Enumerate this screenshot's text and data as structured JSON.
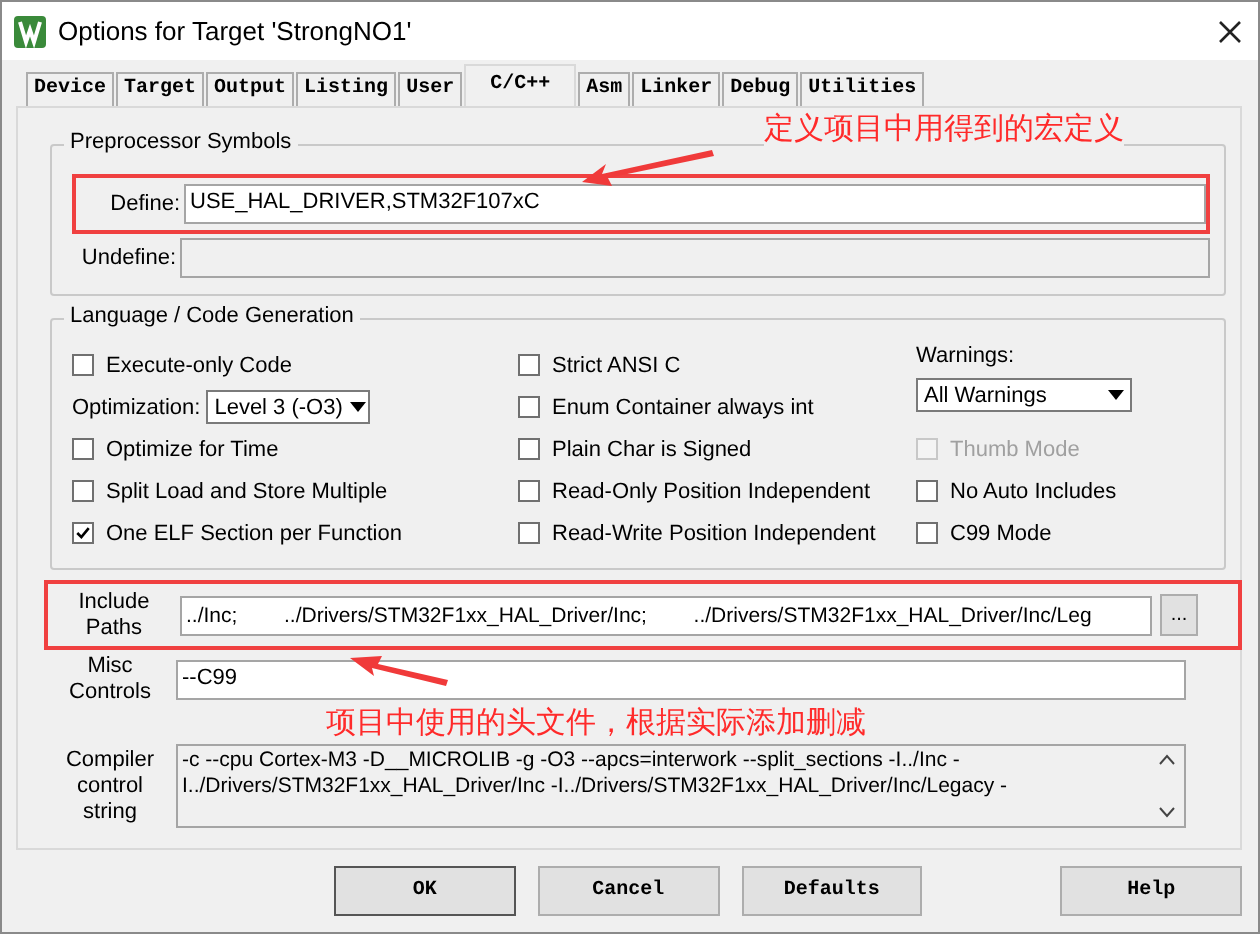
{
  "window": {
    "title": "Options for Target 'StrongNO1'"
  },
  "tabs": [
    {
      "label": "Device",
      "selected": false
    },
    {
      "label": "Target",
      "selected": false
    },
    {
      "label": "Output",
      "selected": false
    },
    {
      "label": "Listing",
      "selected": false
    },
    {
      "label": "User",
      "selected": false
    },
    {
      "label": "C/C++",
      "selected": true
    },
    {
      "label": "Asm",
      "selected": false
    },
    {
      "label": "Linker",
      "selected": false
    },
    {
      "label": "Debug",
      "selected": false
    },
    {
      "label": "Utilities",
      "selected": false
    }
  ],
  "preprocessor": {
    "title": "Preprocessor Symbols",
    "fields": [
      {
        "label": "Define:",
        "value": "USE_HAL_DRIVER,STM32F107xC",
        "disabled": false
      },
      {
        "label": "Undefine:",
        "disabled": true
      }
    ]
  },
  "language": {
    "title": "Language / Code Generation",
    "column_1": [
      {
        "kind": "checkbox",
        "label": "Execute-only Code",
        "checked": false,
        "disabled": false
      },
      {
        "kind": "select",
        "label": "Optimization:",
        "value": "Level 3 (-O3)"
      },
      {
        "kind": "checkbox",
        "label": "Optimize for Time",
        "checked": false,
        "disabled": false
      },
      {
        "kind": "checkbox",
        "label": "Split Load and Store Multiple",
        "checked": false,
        "disabled": false
      },
      {
        "kind": "checkbox",
        "label": "One ELF Section per Function",
        "checked": true,
        "disabled": false
      }
    ],
    "column_2": [
      {
        "kind": "checkbox",
        "label": "Strict ANSI C",
        "checked": false,
        "disabled": false
      },
      {
        "kind": "checkbox",
        "label": "Enum Container always int",
        "checked": false,
        "disabled": false
      },
      {
        "kind": "checkbox",
        "label": "Plain Char is Signed",
        "checked": false,
        "disabled": false
      },
      {
        "kind": "checkbox",
        "label": "Read-Only Position Independent",
        "checked": false,
        "disabled": false
      },
      {
        "kind": "checkbox",
        "label": "Read-Write Position Independent",
        "checked": false,
        "disabled": false
      }
    ],
    "column_3": [
      {
        "kind": "stacked_select",
        "label": "Warnings:",
        "value": "All Warnings"
      },
      {
        "kind": "checkbox",
        "label": "Thumb Mode",
        "checked": false,
        "disabled": true
      },
      {
        "kind": "checkbox",
        "label": "No Auto Includes",
        "checked": false,
        "disabled": false
      },
      {
        "kind": "checkbox",
        "label": "C99 Mode",
        "checked": false,
        "disabled": false
      }
    ]
  },
  "include_paths": {
    "label": "Include Paths",
    "value": "../Inc;        ../Drivers/STM32F1xx_HAL_Driver/Inc;        ../Drivers/STM32F1xx_HAL_Driver/Inc/Leg",
    "browse": "..."
  },
  "misc_controls": {
    "label": "Misc Controls",
    "value": "--C99"
  },
  "compiler_string": {
    "label": "Compiler control string",
    "lines": [
      "-c --cpu Cortex-M3 -D__MICROLIB -g -O3 --apcs=interwork --split_sections -I../Inc -",
      "I../Drivers/STM32F1xx_HAL_Driver/Inc -I../Drivers/STM32F1xx_HAL_Driver/Inc/Legacy -"
    ]
  },
  "buttons": [
    "OK",
    "Cancel",
    "Defaults",
    "Help"
  ],
  "annotations": [
    {
      "text": "定义项目中用得到的宏定义"
    },
    {
      "text": "项目中使用的头文件，根据实际添加删减"
    }
  ]
}
